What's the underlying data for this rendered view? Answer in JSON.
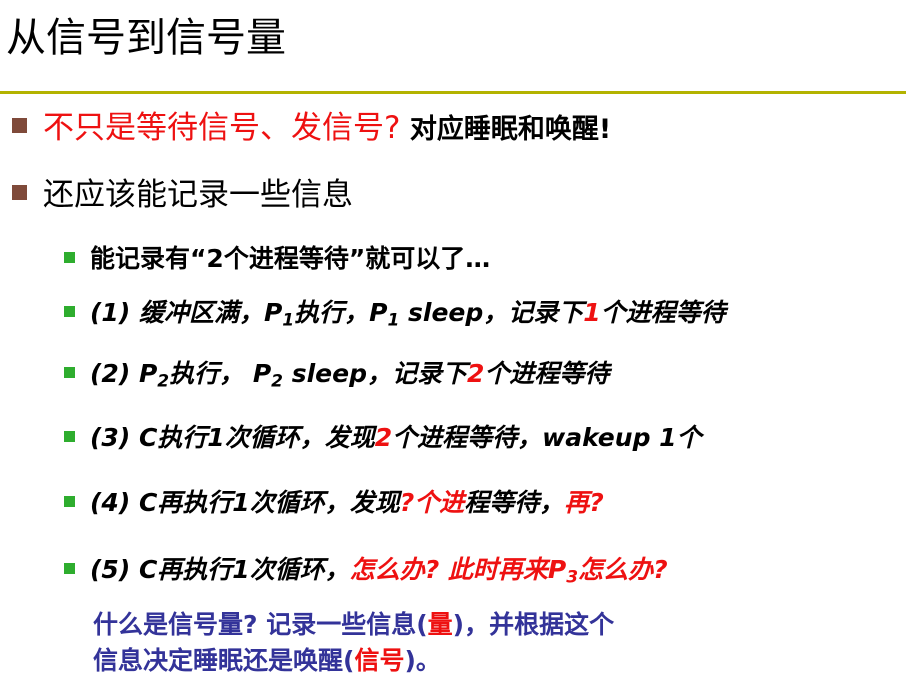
{
  "title": "从信号到信号量",
  "bullets": [
    {
      "red_part": "不只是等待信号、发信号?",
      "black_part": "  对应睡眠和唤醒!"
    },
    {
      "text": "还应该能记录一些信息"
    }
  ],
  "subbullets": [
    {
      "text": "能记录有“2个进程等待”就可以了…"
    },
    {
      "prefix": "(1) 缓冲区满，P",
      "sub1": "1",
      "mid": "执行，P",
      "sub2": "1",
      "mid2": " sleep，记录下",
      "red": "1",
      "suffix": "个进程等待"
    },
    {
      "prefix": "(2) P",
      "sub1": "2",
      "mid": "执行， P",
      "sub2": "2",
      "mid2": " sleep，记录下",
      "red": "2",
      "suffix": "个进程等待"
    },
    {
      "prefix": "(3) C执行1次循环，发现",
      "red": "2",
      "suffix": "个进程等待，wakeup 1个"
    },
    {
      "prefix": "(4) C再执行1次循环，发现",
      "red": "?个进",
      "suffix": "程等待，",
      "red2": "再?"
    },
    {
      "prefix": "(5) C再执行1次循环，",
      "red": "怎么办? 此时再来P",
      "sub": "3",
      "red2": "怎么办?"
    }
  ],
  "note": {
    "line1_a": "什么是信号量?  记录一些信息(",
    "line1_red": "量",
    "line1_b": ")，并根据这个",
    "line2_a": "信息决定睡眠还是唤醒(",
    "line2_red": "信号",
    "line2_b": ")。"
  },
  "colors": {
    "accent_red": "#ee1111",
    "note_blue": "#333399",
    "rule_olive": "#b3b300",
    "bullet_brown": "#7f4a3a",
    "bullet_green": "#2ead2e"
  }
}
